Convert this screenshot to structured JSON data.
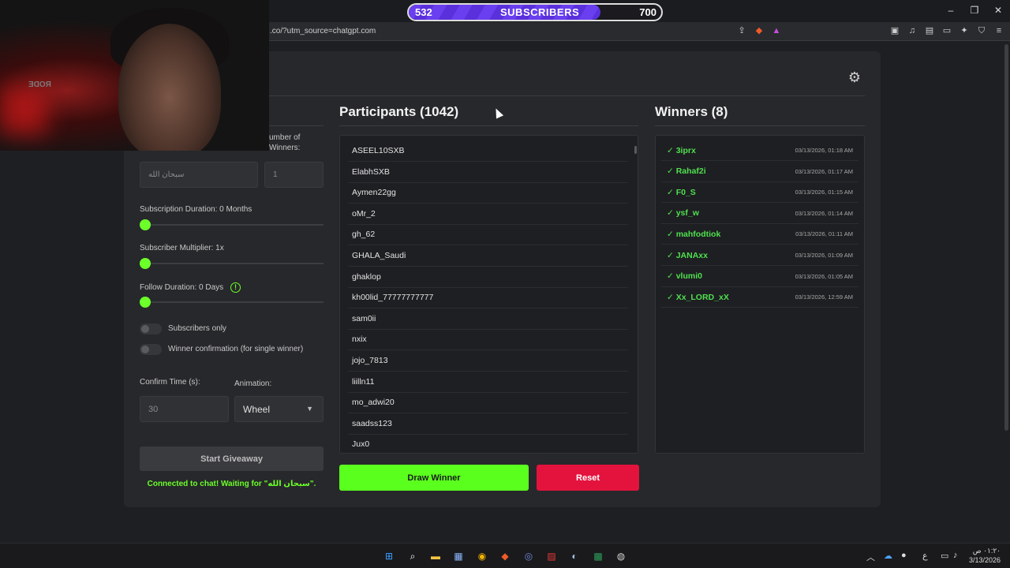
{
  "window": {
    "controls": [
      "–",
      "❐",
      "✕"
    ]
  },
  "subscriber_goal": {
    "current": "532",
    "label": "SUBSCRIBERS",
    "goal": "700",
    "progress_fraction": 0.76
  },
  "address_bar": {
    "url": ".co/?utm_source=chatgpt.com"
  },
  "webcam": {
    "mic_text": "RODE"
  },
  "settings": {
    "winners_label_line1": "umber of",
    "winners_label_line2": "Winners:",
    "keyword_placeholder": "سبحان الله",
    "winners_placeholder": "1",
    "subscription_duration_label": "Subscription Duration: 0 Months",
    "subscriber_multiplier_label": "Subscriber Multiplier: 1x",
    "follow_duration_label": "Follow Duration:  0  Days",
    "info_glyph": "!",
    "subscribers_only_label": "Subscribers only",
    "winner_confirmation_label": "Winner confirmation (for single winner)",
    "confirm_time_label": "Confirm Time (s):",
    "confirm_time_placeholder": "30",
    "animation_label": "Animation:",
    "animation_value": "Wheel",
    "start_button": "Start Giveaway",
    "status_text": "Connected to chat! Waiting for \"سبحان الله\"."
  },
  "participants": {
    "title": "Participants (1042)",
    "items": [
      "ASEEL10SXB",
      "ElabhSXB",
      "Aymen22gg",
      "oMr_2",
      "gh_62",
      "GHALA_Saudi",
      "ghaklop",
      "kh00lid_77777777777",
      "sam0ii",
      "nxix",
      "jojo_7813",
      "liilln11",
      "mo_adwi20",
      "saadss123",
      "Jux0"
    ],
    "draw_button": "Draw Winner",
    "reset_button": "Reset"
  },
  "winners": {
    "title": "Winners (8)",
    "items": [
      {
        "name": "✓ 3iprx",
        "time": "03/13/2026, 01:18 AM"
      },
      {
        "name": "✓ Rahaf2i",
        "time": "03/13/2026, 01:17 AM"
      },
      {
        "name": "✓ F0_S",
        "time": "03/13/2026, 01:15 AM"
      },
      {
        "name": "✓ ysf_w",
        "time": "03/13/2026, 01:14 AM"
      },
      {
        "name": "✓ mahfodtiok",
        "time": "03/13/2026, 01:11 AM"
      },
      {
        "name": "✓ JANAxx",
        "time": "03/13/2026, 01:09 AM"
      },
      {
        "name": "✓ vlumi0",
        "time": "03/13/2026, 01:05 AM"
      },
      {
        "name": "✓ Xx_LORD_xX",
        "time": "03/13/2026, 12:59 AM"
      }
    ]
  },
  "taskbar": {
    "input_indicator": "ع",
    "clock_time": "٠١:٢٠ ص",
    "clock_date": "3/13/2026"
  },
  "colors": {
    "accent_green": "#6cff2a",
    "reset_red": "#e3133d",
    "winner_green": "#4fe04f",
    "sub_bar_purple": "#6a3ff0"
  }
}
